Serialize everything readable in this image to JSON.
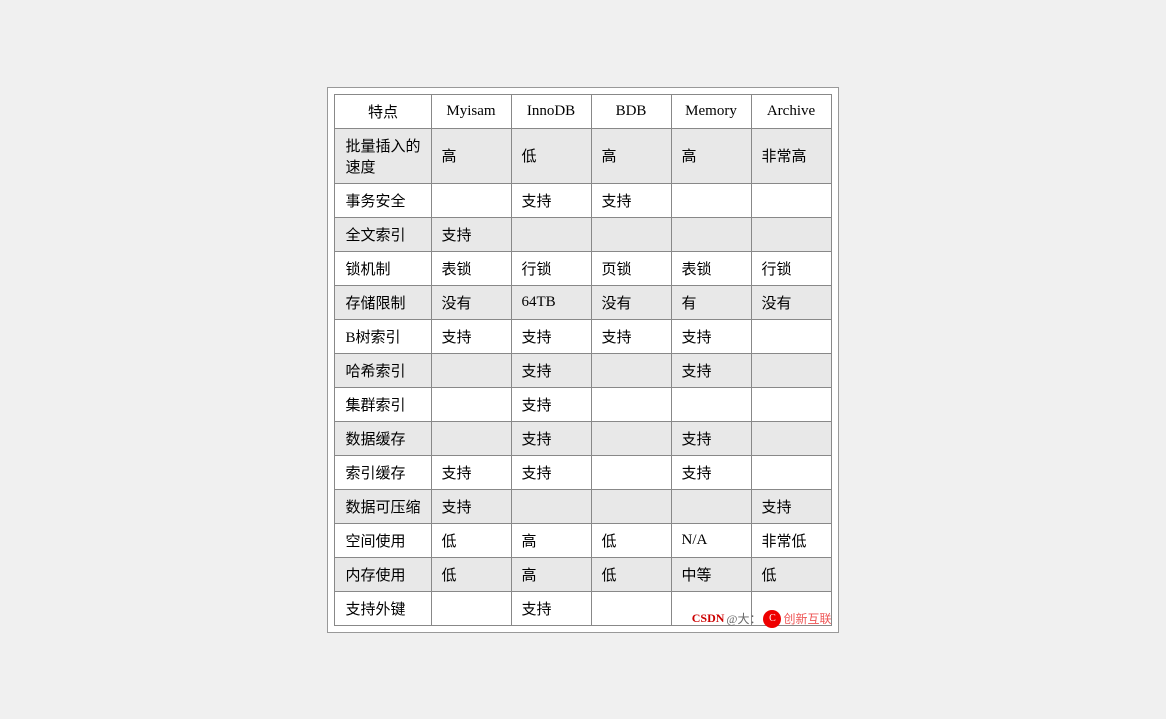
{
  "table": {
    "headers": [
      "特点",
      "Myisam",
      "InnoDB",
      "BDB",
      "Memory",
      "Archive"
    ],
    "rows": [
      {
        "shaded": true,
        "cells": [
          "批量插入的\n速度",
          "高",
          "低",
          "高",
          "高",
          "非常高"
        ]
      },
      {
        "shaded": false,
        "cells": [
          "事务安全",
          "",
          "支持",
          "支持",
          "",
          ""
        ]
      },
      {
        "shaded": true,
        "cells": [
          "全文索引",
          "支持",
          "",
          "",
          "",
          ""
        ]
      },
      {
        "shaded": false,
        "cells": [
          "锁机制",
          "表锁",
          "行锁",
          "页锁",
          "表锁",
          "行锁"
        ]
      },
      {
        "shaded": true,
        "cells": [
          "存储限制",
          "没有",
          "64TB",
          "没有",
          "有",
          "没有"
        ]
      },
      {
        "shaded": false,
        "cells": [
          "B树索引",
          "支持",
          "支持",
          "支持",
          "支持",
          ""
        ]
      },
      {
        "shaded": true,
        "cells": [
          "哈希索引",
          "",
          "支持",
          "",
          "支持",
          ""
        ]
      },
      {
        "shaded": false,
        "cells": [
          "集群索引",
          "",
          "支持",
          "",
          "",
          ""
        ]
      },
      {
        "shaded": true,
        "cells": [
          "数据缓存",
          "",
          "支持",
          "",
          "支持",
          ""
        ]
      },
      {
        "shaded": false,
        "cells": [
          "索引缓存",
          "支持",
          "支持",
          "",
          "支持",
          ""
        ]
      },
      {
        "shaded": true,
        "cells": [
          "数据可压缩",
          "支持",
          "",
          "",
          "",
          "支持"
        ]
      },
      {
        "shaded": false,
        "cells": [
          "空间使用",
          "低",
          "高",
          "低",
          "N/A",
          "非常低"
        ]
      },
      {
        "shaded": true,
        "cells": [
          "内存使用",
          "低",
          "高",
          "低",
          "中等",
          "低"
        ]
      },
      {
        "shaded": false,
        "cells": [
          "支持外键",
          "",
          "支持",
          "",
          "",
          ""
        ]
      }
    ]
  },
  "watermark": {
    "csdn": "CSDN",
    "at": "@大：",
    "icon_label": "C",
    "suffix": "创新互联"
  }
}
